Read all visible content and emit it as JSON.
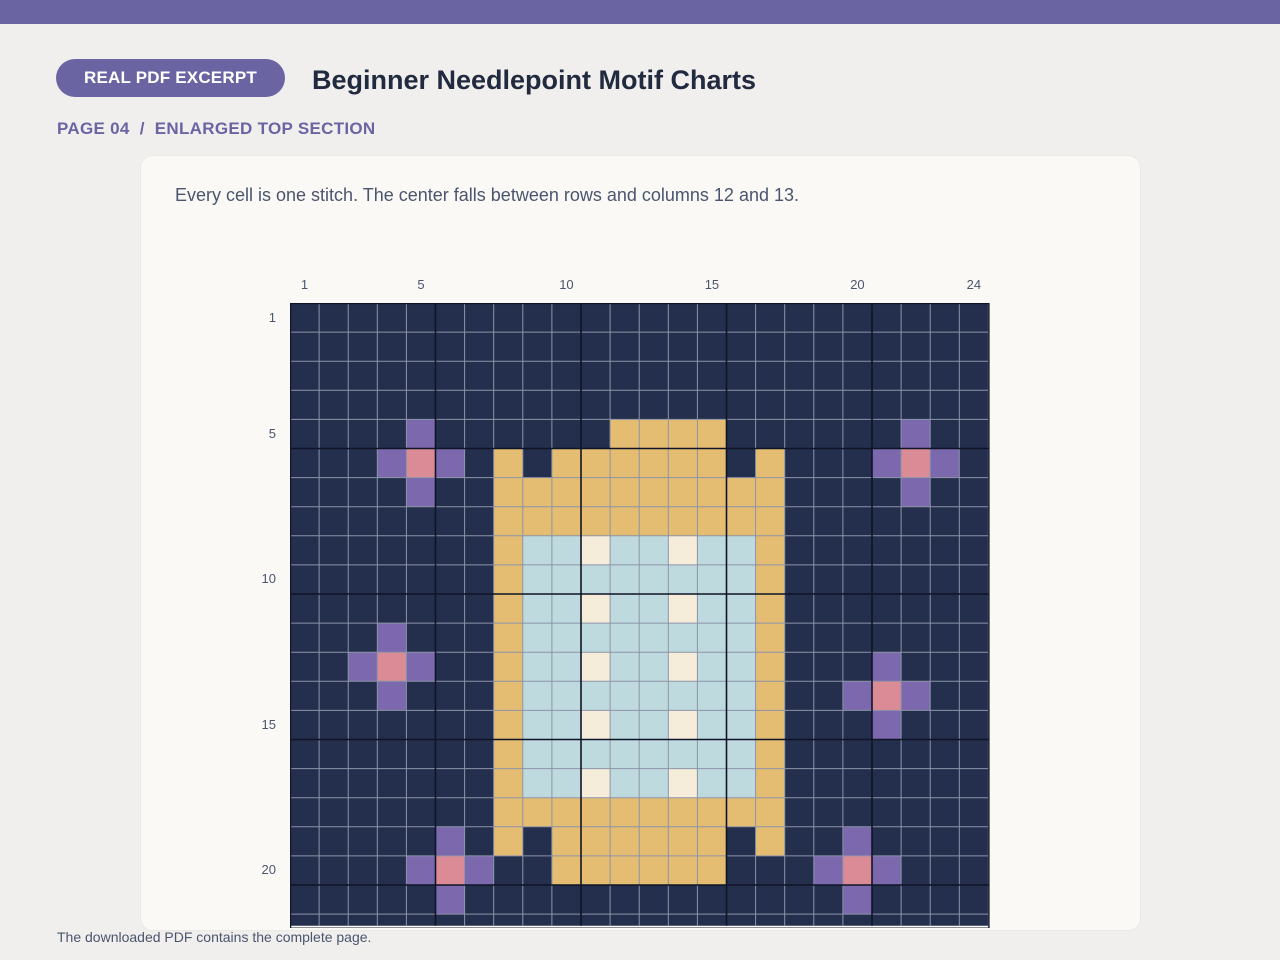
{
  "colors": {
    "topbar": "#6a64a2",
    "pill": "#6a64a2",
    "subtitle": "#6a64a2",
    "background": "#232f4c",
    "gold": "#e4bd72",
    "light_blue": "#bedadf",
    "cream": "#f5ecda",
    "purple": "#7b68ad",
    "pink": "#da8b95",
    "grid_line": "#8d94a8",
    "major_line": "#0f1526"
  },
  "header": {
    "badge": "REAL PDF EXCERPT",
    "title": "Beginner Needlepoint Motif Charts",
    "subtitle": "PAGE 04  /  ENLARGED TOP SECTION"
  },
  "card": {
    "description": "Every cell is one stitch. The center falls between rows and columns 12 and 13."
  },
  "chart": {
    "columns": 24,
    "visible_rows": 21.4,
    "col_labels": [
      {
        "n": 1,
        "label": "1"
      },
      {
        "n": 5,
        "label": "5"
      },
      {
        "n": 10,
        "label": "10"
      },
      {
        "n": 15,
        "label": "15"
      },
      {
        "n": 20,
        "label": "20"
      },
      {
        "n": 24,
        "label": "24"
      }
    ],
    "row_labels": [
      {
        "n": 1,
        "label": "1"
      },
      {
        "n": 5,
        "label": "5"
      },
      {
        "n": 10,
        "label": "10"
      },
      {
        "n": 15,
        "label": "15"
      },
      {
        "n": 20,
        "label": "20"
      }
    ],
    "legend_key": {
      "0": "background",
      "G": "gold",
      "B": "light_blue",
      "C": "cream",
      "P": "purple",
      "K": "pink"
    },
    "rows": [
      "000000000000000000000000",
      "000000000000000000000000",
      "000000000000000000000000",
      "000000000000000000000000",
      "0000P000000GGGG000000P00",
      "000PKP0G0GGGGGG0G000PKP0",
      "0000P00GGGGGGGGGG0000P00",
      "0000000GGGGGGGGGG0000000",
      "0000000GBBCBBCBBG0000000",
      "0000000GBBBBBBBBG0000000",
      "0000000GBBCBBCBBG0000000",
      "000P000GBBBBBBBBG0000000",
      "00PKP00GBBCBBCBBG000P000",
      "000P000GBBBBBBBBG00PKP00",
      "0000000GBBCBBCBBG000P000",
      "0000000GBBBBBBBBG0000000",
      "0000000GBBCBBCBBG0000000",
      "0000000GGGGGGGGGG0000000",
      "00000P0G0GGGGGG0G00P0000",
      "0000PKP00GGGGGG000PKP000",
      "00000P0000000000000P0000",
      "000000000000000000000000"
    ]
  },
  "footer": {
    "note": "The downloaded PDF contains the complete page."
  }
}
